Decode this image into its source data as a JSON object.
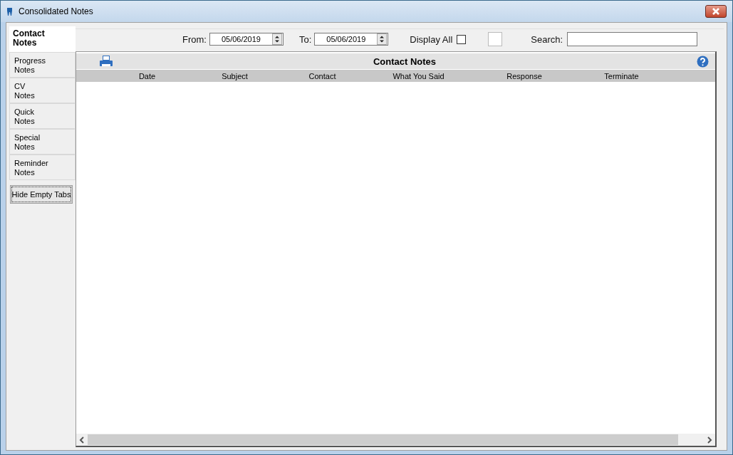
{
  "window": {
    "title": "Consolidated Notes"
  },
  "tabs": [
    {
      "label": "Contact Notes",
      "selected": true
    },
    {
      "label": "Progress Notes",
      "selected": false
    },
    {
      "label": "CV Notes",
      "selected": false
    },
    {
      "label": "Quick Notes",
      "selected": false
    },
    {
      "label": "Special Notes",
      "selected": false
    },
    {
      "label": "Reminder Notes",
      "selected": false
    }
  ],
  "hide_empty_tabs_button": "Hide Empty Tabs",
  "filters": {
    "from_label": "From:",
    "from_value": "05/06/2019",
    "to_label": "To:",
    "to_value": "05/06/2019",
    "display_all_label": "Display All",
    "display_all_checked": false,
    "search_label": "Search:"
  },
  "panel": {
    "title": "Contact Notes",
    "columns": [
      "Date",
      "Subject",
      "Contact",
      "What You Said",
      "Response",
      "Terminate"
    ]
  }
}
